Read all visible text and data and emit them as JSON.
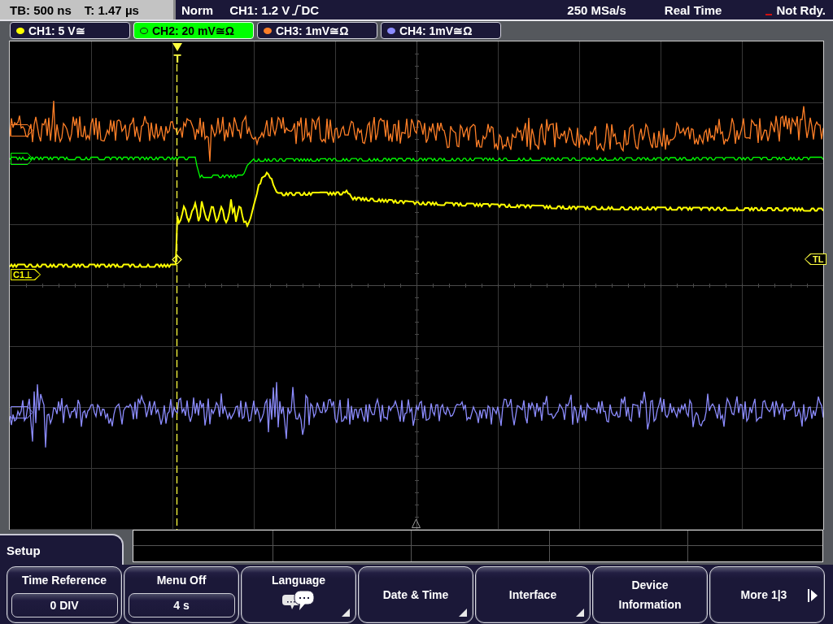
{
  "status_bar": {
    "timebase": "TB: 500 ns",
    "trigger_time": "T: 1.47 µs",
    "trigger_mode": "Norm",
    "trigger_level": "CH1: 1.2 V",
    "coupling": "DC",
    "sample_rate": "250 MSa/s",
    "acquisition": "Real Time",
    "state": "Not Rdy."
  },
  "channels": [
    {
      "label": "CH1: 5 V≅",
      "color": "#ffff00",
      "selected": false
    },
    {
      "label": "CH2: 20 mV≅Ω",
      "color": "#00ff00",
      "selected": true
    },
    {
      "label": "CH3: 1mV≅Ω",
      "color": "#ff7f27",
      "selected": false
    },
    {
      "label": "CH4: 1mV≅Ω",
      "color": "#8c8cff",
      "selected": false
    }
  ],
  "display": {
    "trigger_marker": "T",
    "reference_marker": "C1⊥",
    "level_marker": "TL"
  },
  "menu": {
    "title": "Setup",
    "softkeys": [
      {
        "kind": "value",
        "label": "Time Reference",
        "value": "0 DIV"
      },
      {
        "kind": "value",
        "label": "Menu Off",
        "value": "4 s"
      },
      {
        "kind": "icon_submenu",
        "label": "Language"
      },
      {
        "kind": "submenu",
        "label": "Date & Time"
      },
      {
        "kind": "submenu",
        "label": "Interface"
      },
      {
        "kind": "action",
        "label": "Device Information"
      },
      {
        "kind": "next",
        "label": "More 1|3"
      }
    ]
  }
}
